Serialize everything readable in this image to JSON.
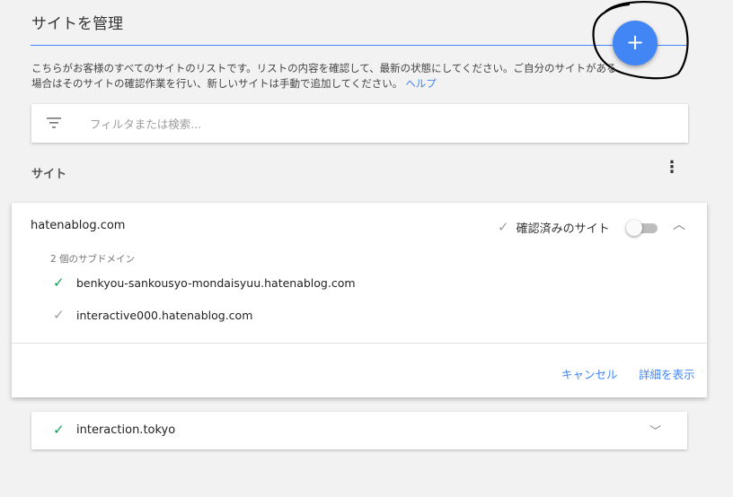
{
  "header": {
    "title": "サイトを管理",
    "add_button_label": "+"
  },
  "description": {
    "text": "こちらがお客様のすべてのサイトのリストです。リストの内容を確認して、最新の状態にしてください。ご自分のサイトがある場合はそのサイトの確認作業を行い、新しいサイトは手動で追加してください。",
    "help_link": "ヘルプ"
  },
  "search": {
    "icon": "filter-icon",
    "placeholder": "フィルタまたは検索..."
  },
  "sites_section": {
    "title": "サイト",
    "more_icon": "⋮"
  },
  "site_card": {
    "domain": "hatenablog.com",
    "verified_label": "確認済みのサイト",
    "toggle_on": false,
    "subdomain_count": "2 個のサブドメイン",
    "subdomains": [
      {
        "name": "benkyou-sankousyo-mondaisyuu.hatenablog.com",
        "status": "verified",
        "status_color": "#0f9d58"
      },
      {
        "name": "interactive000.hatenablog.com",
        "status": "unverified",
        "status_color": "#9e9e9e"
      }
    ],
    "cancel_label": "キャンセル",
    "details_label": "詳細を表示"
  },
  "site_card_2": {
    "domain": "interaction.tokyo",
    "status_color": "#0f9d58"
  },
  "colors": {
    "accent": "#4285f4",
    "verified_green": "#0f9d58",
    "background": "#f2f2f2"
  }
}
